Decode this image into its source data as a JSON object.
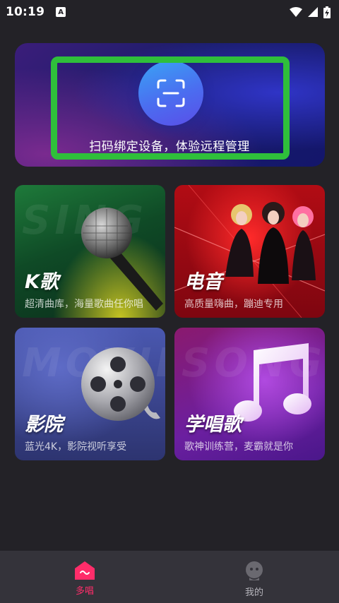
{
  "status_bar": {
    "time": "10:19",
    "notification_icon": "A",
    "icons": [
      "wifi-icon",
      "cell-signal-icon",
      "battery-icon"
    ]
  },
  "banner": {
    "text": "扫码绑定设备，体验远程管理",
    "icon": "scan-icon"
  },
  "cards": [
    {
      "id": "k",
      "title": "K歌",
      "desc": "超清曲库，海量歌曲任你唱",
      "ghost": "SING",
      "icon": "microphone-icon"
    },
    {
      "id": "e",
      "title": "电音",
      "desc": "高质量嗨曲，蹦迪专用",
      "ghost": "",
      "icon": "dj-girls-image"
    },
    {
      "id": "m",
      "title": "影院",
      "desc": "蓝光4K，影院视听享受",
      "ghost": "MOVIE",
      "icon": "film-reel-icon"
    },
    {
      "id": "s",
      "title": "学唱歌",
      "desc": "歌神训练营，麦霸就是你",
      "ghost": "SONG",
      "icon": "music-note-icon"
    }
  ],
  "tabs": [
    {
      "label": "多唱",
      "active": true,
      "icon": "home-icon"
    },
    {
      "label": "我的",
      "active": false,
      "icon": "profile-icon"
    }
  ],
  "colors": {
    "background": "#232227",
    "highlight_frame": "#2fbf3b",
    "active_tab": "#ff2d6a",
    "tabbar": "#34333a"
  }
}
